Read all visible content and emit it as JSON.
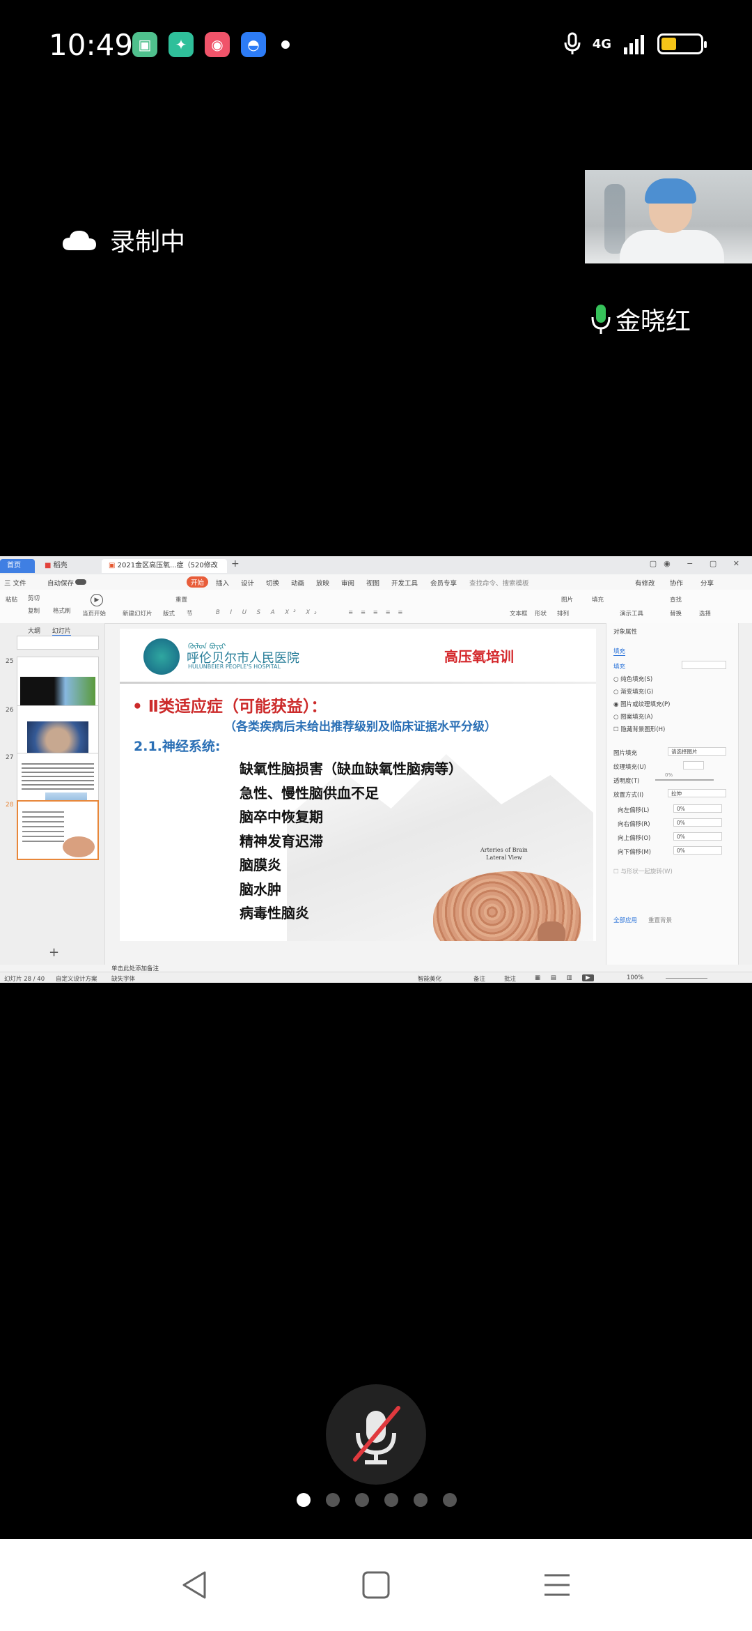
{
  "status_bar": {
    "time": "10:49",
    "network": "4G",
    "battery_level": 0.4,
    "app_icons": [
      "app-green-icon",
      "app-teal-icon",
      "app-red-icon",
      "app-blue-android-icon"
    ]
  },
  "meeting": {
    "recording_label": "录制中",
    "speaker_name": "金晓红"
  },
  "wps": {
    "tabs": {
      "home": "首页",
      "wps": "稻壳",
      "doc": "2021金区高压氧...症（520修改版）"
    },
    "menu": {
      "file": "三 文件",
      "autosave": "自动保存",
      "start": "开始",
      "insert": "插入",
      "design": "设计",
      "transition": "切换",
      "animation": "动画",
      "slideshow": "放映",
      "review": "审阅",
      "view": "视图",
      "dev": "开发工具",
      "member": "会员专享",
      "search": "查找命令、搜索模板",
      "has_changes": "有修改",
      "collab": "协作",
      "share": "分享"
    },
    "ribbon": {
      "cut": "剪切",
      "copy": "复制",
      "format": "格式刷",
      "paste": "粘贴",
      "play_from": "当页开始",
      "new_slide": "新建幻灯片",
      "reset": "重置",
      "layout": "版式",
      "section": "节",
      "textbox": "文本框",
      "shape": "形状",
      "arrange": "排列",
      "picture": "图片",
      "fill": "填充",
      "find": "查找",
      "replace": "替换",
      "select": "选择",
      "tools": "演示工具"
    },
    "thumbs": {
      "outline_tab": "大纲",
      "slides_tab": "幻灯片",
      "numbers": [
        "25",
        "26",
        "27",
        "28"
      ]
    },
    "slide": {
      "hospital_mongol": "ᠬᠥᠯᠥᠨ ᠪᠤᠶᠢᠷ",
      "hospital_cn": "呼伦贝尔市人民医院",
      "hospital_en": "HULUNBEIER PEOPLE'S HOSPITAL",
      "title": "高压氧培训",
      "heading": "• Ⅱ类适应症（可能获益）：",
      "subheading": "（各类疾病后未给出推荐级别及临床证据水平分级）",
      "section": "2.1.神经系统:",
      "items": [
        "缺氧性脑损害（缺血缺氧性脑病等）",
        "急性、慢性脑供血不足",
        "脑卒中恢复期",
        "精神发育迟滞",
        "脑膜炎",
        "脑水肿",
        "病毒性脑炎"
      ],
      "image_caption_1": "Arteries of Brain",
      "image_caption_2": "Lateral View"
    },
    "notes_placeholder": "单击此处添加备注",
    "properties": {
      "title": "对象属性",
      "fill_tab": "填充",
      "fill_section": "填充",
      "options": [
        "纯色填充(S)",
        "渐变填充(G)",
        "图片或纹理填充(P)",
        "图案填充(A)",
        "隐藏背景图形(H)"
      ],
      "picture_fill": "图片填充",
      "picture_fill_value": "请选择图片",
      "texture": "纹理填充(U)",
      "transparency": "透明度(T)",
      "transparency_value": "0%",
      "placement": "放置方式(I)",
      "placement_value": "拉伸",
      "offset_left": "向左偏移(L)",
      "offset_right": "向右偏移(R)",
      "offset_up": "向上偏移(O)",
      "offset_down": "向下偏移(M)",
      "offset_value": "0%",
      "rotate_with": "与形状一起旋转(W)",
      "apply_all": "全部应用",
      "reset_bg": "重置背景"
    },
    "statusline": {
      "slide_count": "幻灯片 28 / 40",
      "theme": "自定义设计方案",
      "font_missing": "缺失字体",
      "smart_beautify": "智能美化",
      "notes": "备注",
      "comments": "批注",
      "zoom": "100%"
    }
  },
  "pager": {
    "pages": 6,
    "current": 1
  }
}
